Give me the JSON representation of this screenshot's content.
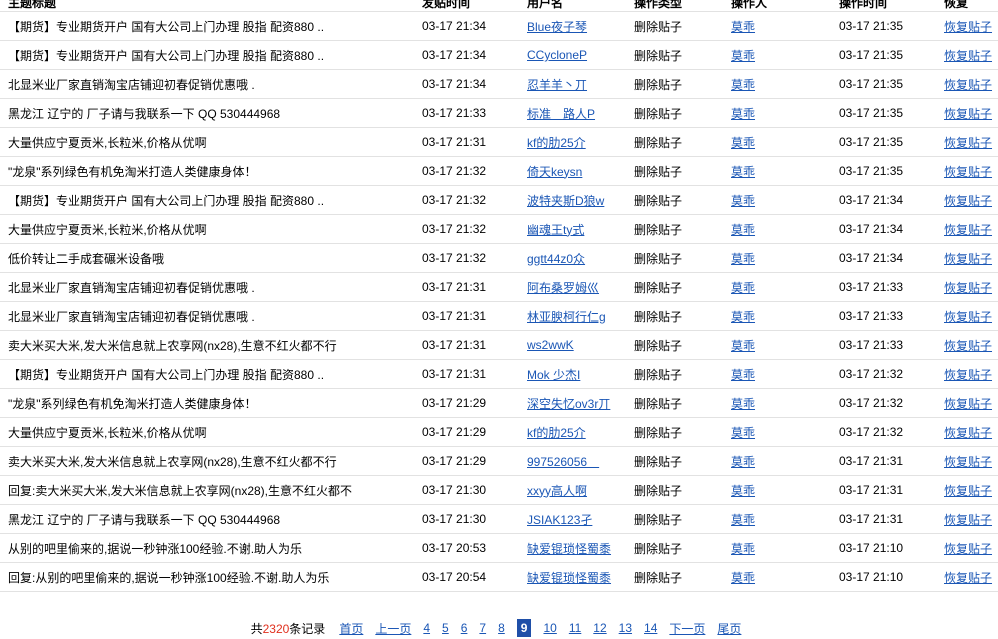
{
  "columns": {
    "title": "主题标题",
    "post_time": "发贴时间",
    "username": "用户名",
    "op_type": "操作类型",
    "operator": "操作人",
    "op_time": "操作时间",
    "restore": "恢复"
  },
  "rows": [
    {
      "title": "【期货】专业期货开户 国有大公司上门办理 股指 配资880 ..",
      "post_time": "03-17 21:34",
      "user": "Blue夜子琴",
      "op_type": "删除贴子",
      "operator": "莫乖",
      "op_time": "03-17 21:35",
      "restore": "恢复贴子"
    },
    {
      "title": "【期货】专业期货开户 国有大公司上门办理 股指 配资880 ..",
      "post_time": "03-17 21:34",
      "user": "CCycloneP",
      "op_type": "删除贴子",
      "operator": "莫乖",
      "op_time": "03-17 21:35",
      "restore": "恢复贴子"
    },
    {
      "title": "北显米业厂家直销淘宝店铺迎初春促销优惠哦 .",
      "post_time": "03-17 21:34",
      "user": "忍羊羊丶丌",
      "op_type": "删除贴子",
      "operator": "莫乖",
      "op_time": "03-17 21:35",
      "restore": "恢复贴子"
    },
    {
      "title": "黑龙江 辽宁的 厂子请与我联系一下 QQ 530444968",
      "post_time": "03-17 21:33",
      "user": "标准＿路人P",
      "op_type": "删除贴子",
      "operator": "莫乖",
      "op_time": "03-17 21:35",
      "restore": "恢复贴子"
    },
    {
      "title": "大量供应宁夏贡米,长粒米,价格从优啊",
      "post_time": "03-17 21:31",
      "user": "kf的肋25介",
      "op_type": "删除贴子",
      "operator": "莫乖",
      "op_time": "03-17 21:35",
      "restore": "恢复贴子"
    },
    {
      "title": "\"龙泉\"系列绿色有机免淘米打造人类健康身体！",
      "post_time": "03-17 21:32",
      "user": "倚天keysn",
      "op_type": "删除贴子",
      "operator": "莫乖",
      "op_time": "03-17 21:35",
      "restore": "恢复贴子"
    },
    {
      "title": "【期货】专业期货开户 国有大公司上门办理 股指 配资880 ..",
      "post_time": "03-17 21:32",
      "user": "波特夹斯D狼w",
      "op_type": "删除贴子",
      "operator": "莫乖",
      "op_time": "03-17 21:34",
      "restore": "恢复贴子"
    },
    {
      "title": "大量供应宁夏贡米,长粒米,价格从优啊",
      "post_time": "03-17 21:32",
      "user": "幽魂王ty式",
      "op_type": "删除贴子",
      "operator": "莫乖",
      "op_time": "03-17 21:34",
      "restore": "恢复贴子"
    },
    {
      "title": "低价转让二手成套碾米设备哦",
      "post_time": "03-17 21:32",
      "user": "ggtt44z0众",
      "op_type": "删除贴子",
      "operator": "莫乖",
      "op_time": "03-17 21:34",
      "restore": "恢复贴子"
    },
    {
      "title": "北显米业厂家直销淘宝店铺迎初春促销优惠哦 .",
      "post_time": "03-17 21:31",
      "user": "阿布桑罗姆巛",
      "op_type": "删除贴子",
      "operator": "莫乖",
      "op_time": "03-17 21:33",
      "restore": "恢复贴子"
    },
    {
      "title": "北显米业厂家直销淘宝店铺迎初春促销优惠哦 .",
      "post_time": "03-17 21:31",
      "user": "林亚腴柯行仁g",
      "op_type": "删除贴子",
      "operator": "莫乖",
      "op_time": "03-17 21:33",
      "restore": "恢复贴子"
    },
    {
      "title": "卖大米买大米,发大米信息就上农享网(nx28),生意不红火都不行",
      "post_time": "03-17 21:31",
      "user": "ws2wwK",
      "op_type": "删除贴子",
      "operator": "莫乖",
      "op_time": "03-17 21:33",
      "restore": "恢复贴子"
    },
    {
      "title": "【期货】专业期货开户 国有大公司上门办理 股指 配资880 ..",
      "post_time": "03-17 21:31",
      "user": "Mok 少杰I",
      "op_type": "删除贴子",
      "operator": "莫乖",
      "op_time": "03-17 21:32",
      "restore": "恢复贴子"
    },
    {
      "title": "\"龙泉\"系列绿色有机免淘米打造人类健康身体！",
      "post_time": "03-17 21:29",
      "user": "深空失忆ov3r丌",
      "op_type": "删除贴子",
      "operator": "莫乖",
      "op_time": "03-17 21:32",
      "restore": "恢复贴子"
    },
    {
      "title": "大量供应宁夏贡米,长粒米,价格从优啊",
      "post_time": "03-17 21:29",
      "user": "kf的肋25介",
      "op_type": "删除贴子",
      "operator": "莫乖",
      "op_time": "03-17 21:32",
      "restore": "恢复贴子"
    },
    {
      "title": "卖大米买大米,发大米信息就上农享网(nx28),生意不红火都不行",
      "post_time": "03-17 21:29",
      "user": "997526056＿",
      "op_type": "删除贴子",
      "operator": "莫乖",
      "op_time": "03-17 21:31",
      "restore": "恢复贴子"
    },
    {
      "title": "回复:卖大米买大米,发大米信息就上农享网(nx28),生意不红火都不",
      "post_time": "03-17 21:30",
      "user": "xxyy高人啊",
      "op_type": "删除贴子",
      "operator": "莫乖",
      "op_time": "03-17 21:31",
      "restore": "恢复贴子"
    },
    {
      "title": "黑龙江 辽宁的 厂子请与我联系一下 QQ 530444968",
      "post_time": "03-17 21:30",
      "user": "JSIAK123孑",
      "op_type": "删除贴子",
      "operator": "莫乖",
      "op_time": "03-17 21:31",
      "restore": "恢复贴子"
    },
    {
      "title": "从别的吧里偷来的,据说一秒钟涨100经验.不谢.助人为乐",
      "post_time": "03-17 20:53",
      "user": "缺爱锟琐怪蜀黍",
      "op_type": "删除贴子",
      "operator": "莫乖",
      "op_time": "03-17 21:10",
      "restore": "恢复贴子"
    },
    {
      "title": "回复:从别的吧里偷来的,据说一秒钟涨100经验.不谢.助人为乐",
      "post_time": "03-17 20:54",
      "user": "缺爱锟琐怪蜀黍",
      "op_type": "删除贴子",
      "operator": "莫乖",
      "op_time": "03-17 21:10",
      "restore": "恢复贴子"
    }
  ],
  "pager": {
    "summary_prefix": "共",
    "total": "2320",
    "summary_suffix": "条记录",
    "first": "首页",
    "prev": "上一页",
    "pages_before": [
      "4",
      "5",
      "6",
      "7",
      "8"
    ],
    "current": "9",
    "pages_after": [
      "10",
      "11",
      "12",
      "13",
      "14"
    ],
    "next": "下一页",
    "last": "尾页"
  },
  "colors": {
    "link": "#1a56b5",
    "count": "#e0301e",
    "current_page_bg": "#1f4fa8"
  }
}
